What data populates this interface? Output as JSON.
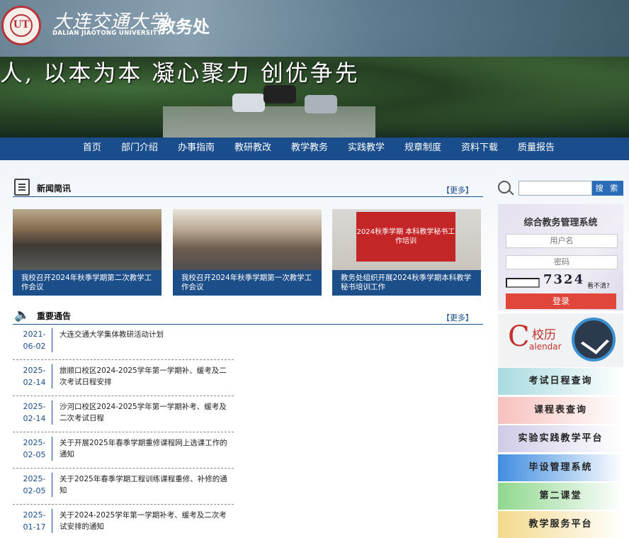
{
  "header": {
    "seal_mark": "UT",
    "school_cn": "大连交通大学",
    "school_en": "DALIAN JIAOTONG UNIVERSITY",
    "dept_title": "教务处",
    "slogan": "人, 以本为本  凝心聚力  创优争先"
  },
  "nav": {
    "items": [
      "首页",
      "部门介绍",
      "办事指南",
      "教研教改",
      "教学教务",
      "实践教学",
      "规章制度",
      "资料下载",
      "质量报告"
    ]
  },
  "news": {
    "title": "新闻简讯",
    "more": "【更多】",
    "items": [
      {
        "caption": "我校召开2024年秋季学期第二次教学工作会议"
      },
      {
        "caption": "我校召开2024年秋季学期第一次教学工作会议"
      },
      {
        "caption": "教务处组织开展2024秋季学期本科教学秘书培训工作",
        "screen_text": "2024秋季学期 本科教学秘书工作培训"
      }
    ]
  },
  "notices": {
    "title": "重要通告",
    "more": "【更多】",
    "items": [
      {
        "year": "2021-",
        "md": "06-02",
        "title": "大连交通大学集体教研活动计划"
      },
      {
        "year": "2025-",
        "md": "02-14",
        "title": "旅顺口校区2024-2025学年第一学期补、缓考及二次考试日程安排"
      },
      {
        "year": "2025-",
        "md": "02-14",
        "title": "沙河口校区2024-2025学年第一学期补考、缓考及二次考试日程"
      },
      {
        "year": "2025-",
        "md": "02-05",
        "title": "关于开展2025年春季学期重修课程网上选课工作的通知"
      },
      {
        "year": "2025-",
        "md": "02-05",
        "title": "关于2025年春季学期工程训练课程重修、补修的通知"
      },
      {
        "year": "2025-",
        "md": "01-17",
        "title": "关于2024-2025学年第一学期补考、缓考及二次考试安排的通知"
      }
    ]
  },
  "search": {
    "button_label": "搜 索"
  },
  "login": {
    "title": "综合教务管理系统",
    "username_placeholder": "用户名",
    "password_placeholder": "密码",
    "captcha": "7324",
    "cant_see": "看不清?",
    "button": "登录"
  },
  "calendar": {
    "letter": "C",
    "cn": "校历",
    "en": "alendar"
  },
  "portals": [
    {
      "label": "考试日程查询",
      "color": "#a8dbe0"
    },
    {
      "label": "课程表查询",
      "color": "#f6c1bd"
    },
    {
      "label": "实验实践教学平台",
      "color": "#cfcbe8"
    },
    {
      "label": "毕设管理系统",
      "color": "#3f8de0"
    },
    {
      "label": "第二课堂",
      "color": "#8fd78e"
    },
    {
      "label": "教学服务平台",
      "color": "#f3d98c"
    }
  ]
}
